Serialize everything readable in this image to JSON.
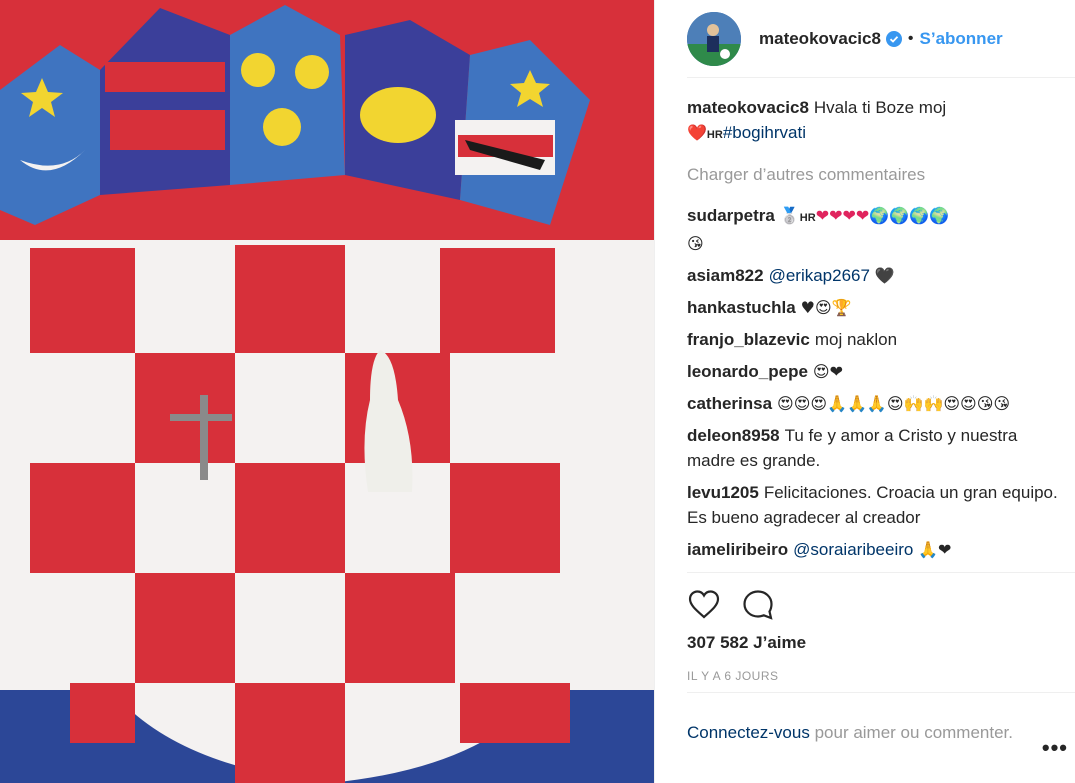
{
  "header": {
    "username": "mateokovacic8",
    "separator": "•",
    "follow_label": "S’abonner"
  },
  "caption": {
    "username": "mateokovacic8",
    "text": "Hvala ti Boze moj",
    "emoji": "❤️",
    "flag_text": "HR",
    "hashtag": "#bogihrvati"
  },
  "load_more_label": "Charger d’autres commentaires",
  "comments": [
    {
      "user": "sudarpetra",
      "medal": "🥈",
      "flag": "HR",
      "hearts": "❤❤❤❤",
      "globes": "🌍🌍🌍🌍",
      "tail": "😘"
    },
    {
      "user": "asiam822",
      "mention": "@erikap2667",
      "tail": "🖤"
    },
    {
      "user": "hankastuchla",
      "tail": "♥😍🏆"
    },
    {
      "user": "franjo_blazevic",
      "text": "moj naklon"
    },
    {
      "user": "leonardo_pepe",
      "tail": "😍❤"
    },
    {
      "user": "catherinsa",
      "tail": "😍😍😍🙏🙏🙏😍🙌🙌😍😍😘😘"
    },
    {
      "user": "deleon8958",
      "text": "Tu fe y amor a Cristo y nuestra madre es grande."
    },
    {
      "user": "levu1205",
      "text": "Felicitaciones. Croacia un gran equipo. Es bueno agradecer al creador"
    },
    {
      "user": "iameliribeiro",
      "mention": "@soraiaribeeiro",
      "tail": "🙏❤"
    }
  ],
  "likes": "307 582 J’aime",
  "time": "IL Y A 6 JOURS",
  "login": {
    "link": "Connectez-vous",
    "rest": "pour aimer ou commenter."
  },
  "more_label": "•••",
  "icons": {
    "like": "heart-icon",
    "comment": "comment-icon",
    "verified": "verified-badge-icon",
    "more": "more-options-icon"
  },
  "colors": {
    "follow": "#3897f0",
    "link": "#003569",
    "muted": "#999999",
    "flag_red": "#d9313b",
    "flag_blue": "#2f4a9a"
  }
}
